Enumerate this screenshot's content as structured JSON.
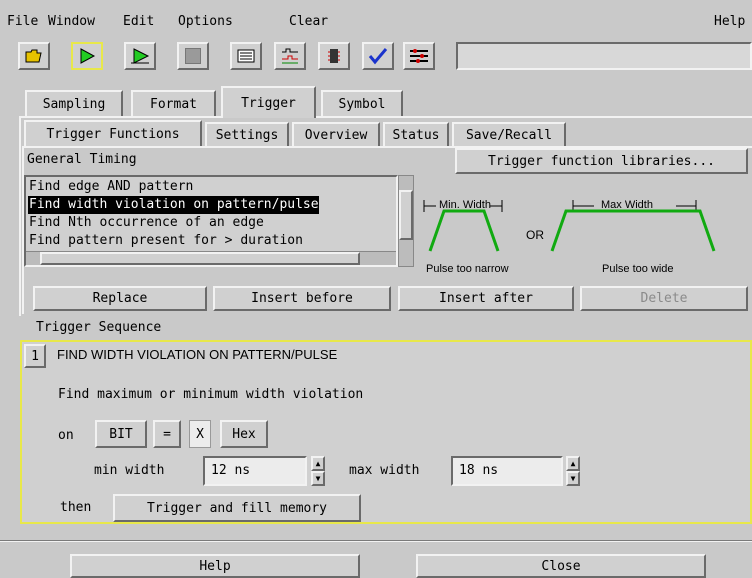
{
  "menu": {
    "file": "File",
    "window": "Window",
    "edit": "Edit",
    "options": "Options",
    "clear": "Clear",
    "help": "Help"
  },
  "toolbar": {
    "icons": [
      "open-folder-icon",
      "run-icon",
      "run-repetitive-icon",
      "stop-icon",
      "listing-icon",
      "waveform-icon",
      "chip-icon",
      "check-icon",
      "setup-icon"
    ],
    "status_text": ""
  },
  "tabs": {
    "sampling": "Sampling",
    "format": "Format",
    "trigger": "Trigger",
    "symbol": "Symbol"
  },
  "subtabs": {
    "functions": "Trigger Functions",
    "settings": "Settings",
    "overview": "Overview",
    "status": "Status",
    "saverecall": "Save/Recall"
  },
  "functions_panel": {
    "category": "General Timing",
    "libraries_button": "Trigger function libraries...",
    "items": [
      "Find edge AND pattern",
      "Find width violation on pattern/pulse",
      "Find Nth occurrence of an edge",
      "Find pattern present for > duration"
    ],
    "selected_index": 1,
    "diagram": {
      "min_width": "Min. Width",
      "max_width": "Max Width",
      "or": "OR",
      "too_narrow": "Pulse too narrow",
      "too_wide": "Pulse too wide"
    },
    "buttons": {
      "replace": "Replace",
      "insert_before": "Insert before",
      "insert_after": "Insert after",
      "delete": "Delete"
    }
  },
  "sequence": {
    "label": "Trigger Sequence",
    "step_number": "1",
    "step_title": "FIND WIDTH VIOLATION ON PATTERN/PULSE",
    "description": "Find maximum or minimum width violation",
    "on_label": "on",
    "bit_button": "BIT",
    "eq_button": "=",
    "value": "X",
    "hex_button": "Hex",
    "min_label": "min width",
    "min_value": "12 ns",
    "max_label": "max width",
    "max_value": "18 ns",
    "then_label": "then",
    "action_button": "Trigger and fill memory"
  },
  "footer": {
    "help": "Help",
    "close": "Close"
  },
  "colors": {
    "selected_bg": "#000000",
    "selected_fg": "#ffffff",
    "accent_yellow": "#e8e84a",
    "pulse_green": "#11aa11"
  }
}
